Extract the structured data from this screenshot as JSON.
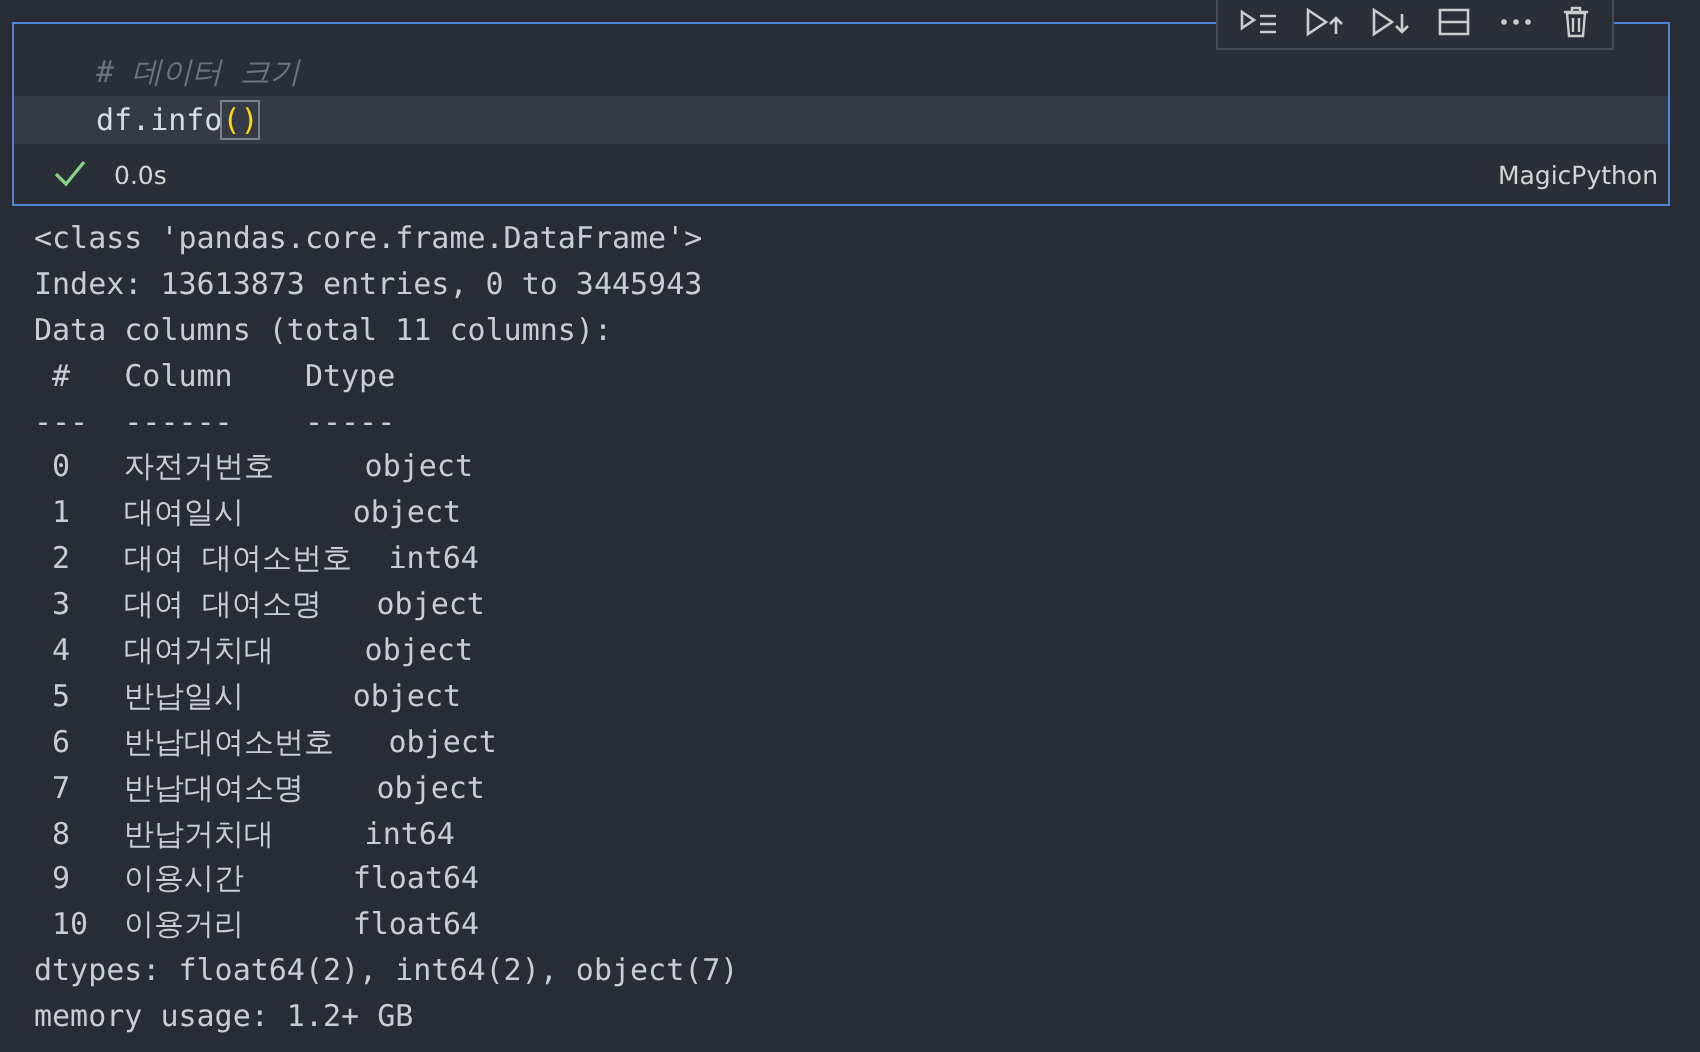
{
  "cell": {
    "code_lines": [
      {
        "current": false,
        "parts": [
          {
            "kind": "comment",
            "text": "# 데이터 크기"
          }
        ]
      },
      {
        "current": true,
        "parts": [
          {
            "kind": "plain",
            "text": "df.info"
          },
          {
            "kind": "bracket",
            "text": "()"
          }
        ]
      }
    ],
    "status": {
      "succeeded": true,
      "duration": "0.0s",
      "language": "MagicPython"
    }
  },
  "output": {
    "lines": [
      "<class 'pandas.core.frame.DataFrame'>",
      "Index: 13613873 entries, 0 to 3445943",
      "Data columns (total 11 columns):",
      " #   Column    Dtype ",
      "---  ------    ----- ",
      " 0   자전거번호     object",
      " 1   대여일시      object",
      " 2   대여 대여소번호  int64 ",
      " 3   대여 대여소명   object",
      " 4   대여거치대     object",
      " 5   반납일시      object",
      " 6   반납대여소번호   object",
      " 7   반납대여소명    object",
      " 8   반납거치대     int64 ",
      " 9   이용시간      float64",
      " 10  이용거리      float64",
      "dtypes: float64(2), int64(2), object(7)",
      "memory usage: 1.2+ GB"
    ]
  }
}
